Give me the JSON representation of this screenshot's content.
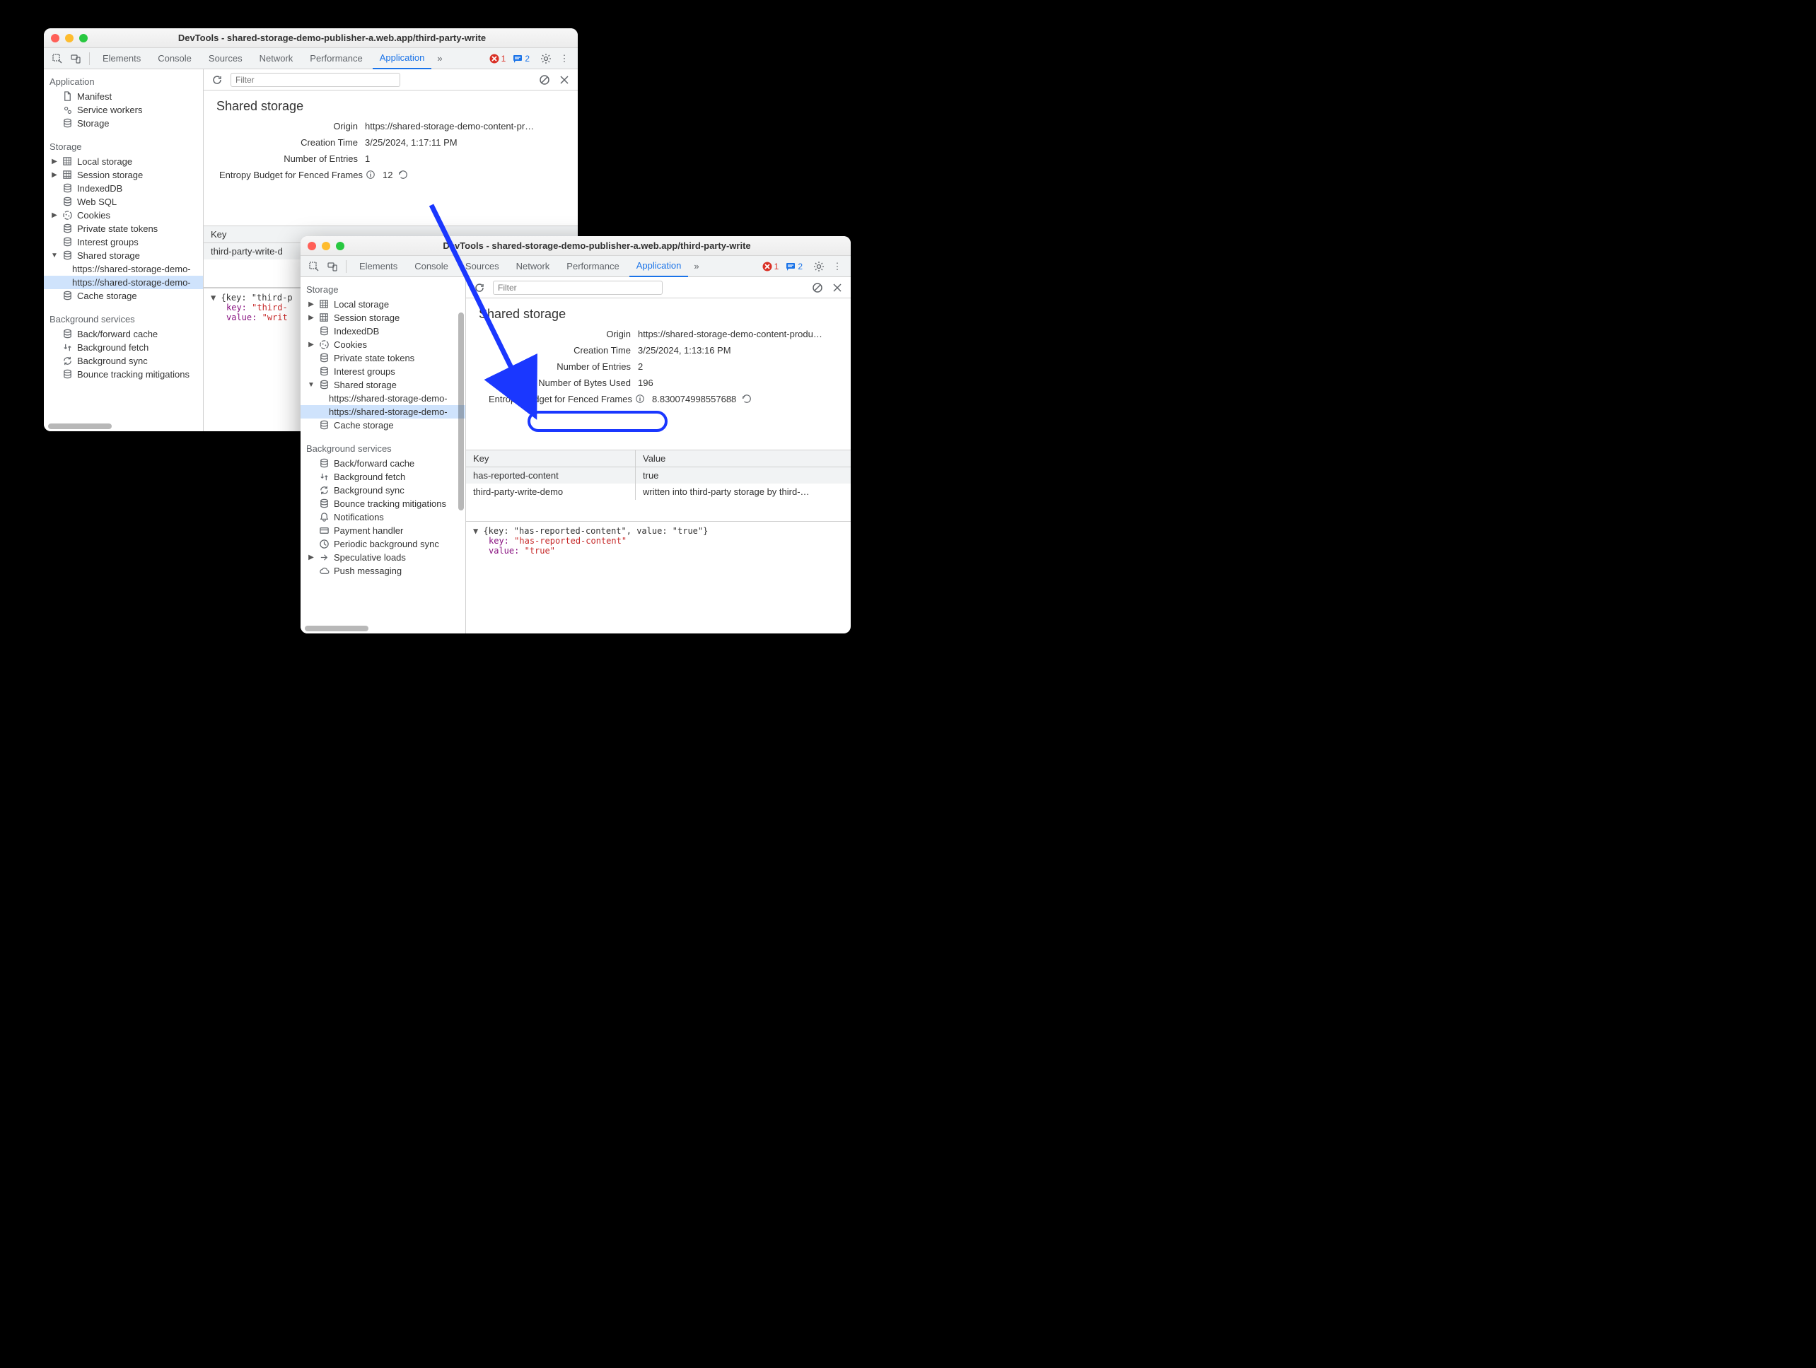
{
  "window1": {
    "title": "DevTools - shared-storage-demo-publisher-a.web.app/third-party-write",
    "tabs": [
      "Elements",
      "Console",
      "Sources",
      "Network",
      "Performance",
      "Application"
    ],
    "active_tab": "Application",
    "more_glyph": "»",
    "err_count": "1",
    "info_count": "2",
    "sidebar": {
      "application_h": "Application",
      "app_items": [
        "Manifest",
        "Service workers",
        "Storage"
      ],
      "storage_h": "Storage",
      "storage_items": [
        "Local storage",
        "Session storage",
        "IndexedDB",
        "Web SQL",
        "Cookies",
        "Private state tokens",
        "Interest groups",
        "Shared storage"
      ],
      "shared_urls": [
        "https://shared-storage-demo-",
        "https://shared-storage-demo-"
      ],
      "cache_item": "Cache storage",
      "bg_h": "Background services",
      "bg_items": [
        "Back/forward cache",
        "Background fetch",
        "Background sync",
        "Bounce tracking mitigations"
      ]
    },
    "filter_placeholder": "Filter",
    "pane_title": "Shared storage",
    "kv": {
      "origin_k": "Origin",
      "origin_v": "https://shared-storage-demo-content-pr…",
      "ctime_k": "Creation Time",
      "ctime_v": "3/25/2024, 1:17:11 PM",
      "entries_k": "Number of Entries",
      "entries_v": "1",
      "entropy_k": "Entropy Budget for Fenced Frames",
      "entropy_v": "12"
    },
    "table": {
      "key_h": "Key",
      "rows": [
        {
          "key": "third-party-write-d"
        }
      ]
    },
    "detail": {
      "line1": "{key: \"third-p",
      "key_label": "key:",
      "key_v": "\"third-",
      "val_label": "value:",
      "val_v": "\"writ"
    }
  },
  "window2": {
    "title": "DevTools - shared-storage-demo-publisher-a.web.app/third-party-write",
    "tabs": [
      "Elements",
      "Console",
      "Sources",
      "Network",
      "Performance",
      "Application"
    ],
    "active_tab": "Application",
    "more_glyph": "»",
    "err_count": "1",
    "info_count": "2",
    "sidebar": {
      "storage_h": "Storage",
      "storage_items": [
        "Local storage",
        "Session storage",
        "IndexedDB",
        "Cookies",
        "Private state tokens",
        "Interest groups",
        "Shared storage"
      ],
      "shared_urls": [
        "https://shared-storage-demo-",
        "https://shared-storage-demo-"
      ],
      "cache_item": "Cache storage",
      "bg_h": "Background services",
      "bg_items": [
        "Back/forward cache",
        "Background fetch",
        "Background sync",
        "Bounce tracking mitigations",
        "Notifications",
        "Payment handler",
        "Periodic background sync",
        "Speculative loads",
        "Push messaging"
      ]
    },
    "filter_placeholder": "Filter",
    "pane_title": "Shared storage",
    "kv": {
      "origin_k": "Origin",
      "origin_v": "https://shared-storage-demo-content-produ…",
      "ctime_k": "Creation Time",
      "ctime_v": "3/25/2024, 1:13:16 PM",
      "entries_k": "Number of Entries",
      "entries_v": "2",
      "bytes_k": "Number of Bytes Used",
      "bytes_v": "196",
      "entropy_k": "Entropy Budget for Fenced Frames",
      "entropy_v": "8.830074998557688"
    },
    "table": {
      "key_h": "Key",
      "val_h": "Value",
      "rows": [
        {
          "key": "has-reported-content",
          "val": "true"
        },
        {
          "key": "third-party-write-demo",
          "val": "written into third-party storage by third-…"
        }
      ]
    },
    "detail": {
      "line1": "{key: \"has-reported-content\", value: \"true\"}",
      "key_label": "key:",
      "key_v": "\"has-reported-content\"",
      "val_label": "value:",
      "val_v": "\"true\""
    }
  }
}
